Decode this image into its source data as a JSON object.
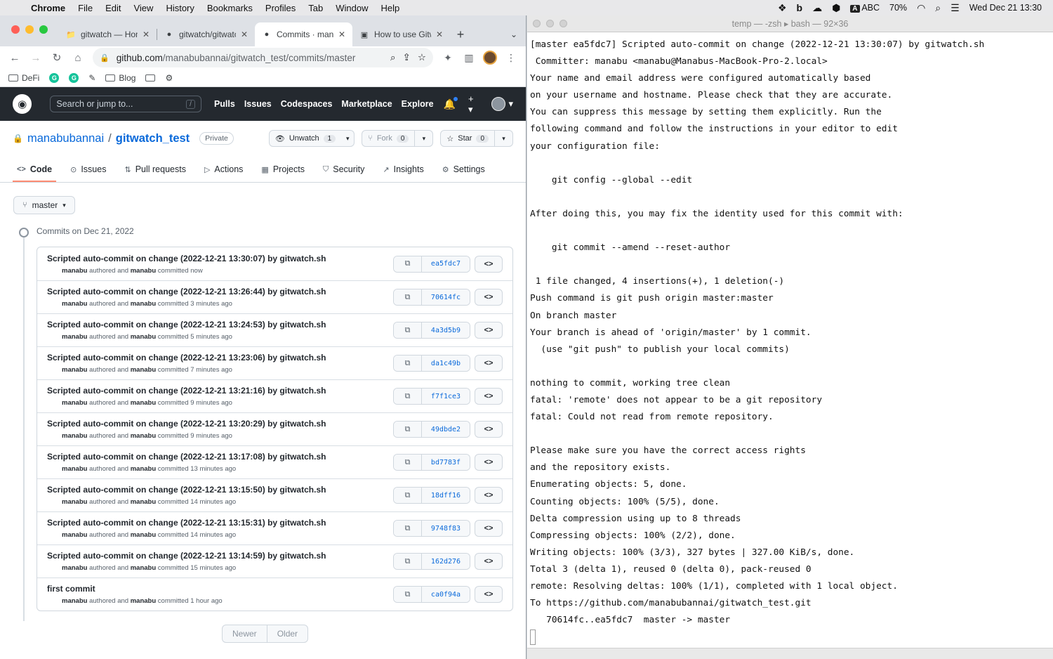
{
  "menubar": {
    "app": "Chrome",
    "items": [
      "File",
      "Edit",
      "View",
      "History",
      "Bookmarks",
      "Profiles",
      "Tab",
      "Window",
      "Help"
    ],
    "input_source": "ABC",
    "battery": "70%",
    "datetime": "Wed Dec 21  13:30"
  },
  "browser": {
    "tabs": [
      {
        "label": "gitwatch — Hom"
      },
      {
        "label": "gitwatch/gitwatc"
      },
      {
        "label": "Commits · mana"
      },
      {
        "label": "How to use Gitw"
      }
    ],
    "url_host": "github.com",
    "url_path": "/manabubannai/gitwatch_test/commits/master",
    "bookmarks": [
      "DeFi",
      "Blog"
    ]
  },
  "github": {
    "search_placeholder": "Search or jump to...",
    "search_key": "/",
    "nav": [
      "Pulls",
      "Issues",
      "Codespaces",
      "Marketplace",
      "Explore"
    ],
    "repo_owner": "manabubannai",
    "repo_sep": "/",
    "repo_name": "gitwatch_test",
    "visibility": "Private",
    "unwatch_label": "Unwatch",
    "unwatch_count": "1",
    "fork_label": "Fork",
    "fork_count": "0",
    "star_label": "Star",
    "star_count": "0",
    "tabs": [
      "Code",
      "Issues",
      "Pull requests",
      "Actions",
      "Projects",
      "Security",
      "Insights",
      "Settings"
    ],
    "branch": "master",
    "commits_date": "Commits on Dec 21, 2022",
    "commits": [
      {
        "title": "Scripted auto-commit on change (2022-12-21 13:30:07) by gitwatch.sh",
        "author": "manabu",
        "committer": "manabu",
        "when": "committed now",
        "sha": "ea5fdc7"
      },
      {
        "title": "Scripted auto-commit on change (2022-12-21 13:26:44) by gitwatch.sh",
        "author": "manabu",
        "committer": "manabu",
        "when": "committed 3 minutes ago",
        "sha": "70614fc"
      },
      {
        "title": "Scripted auto-commit on change (2022-12-21 13:24:53) by gitwatch.sh",
        "author": "manabu",
        "committer": "manabu",
        "when": "committed 5 minutes ago",
        "sha": "4a3d5b9"
      },
      {
        "title": "Scripted auto-commit on change (2022-12-21 13:23:06) by gitwatch.sh",
        "author": "manabu",
        "committer": "manabu",
        "when": "committed 7 minutes ago",
        "sha": "da1c49b"
      },
      {
        "title": "Scripted auto-commit on change (2022-12-21 13:21:16) by gitwatch.sh",
        "author": "manabu",
        "committer": "manabu",
        "when": "committed 9 minutes ago",
        "sha": "f7f1ce3"
      },
      {
        "title": "Scripted auto-commit on change (2022-12-21 13:20:29) by gitwatch.sh",
        "author": "manabu",
        "committer": "manabu",
        "when": "committed 9 minutes ago",
        "sha": "49dbde2"
      },
      {
        "title": "Scripted auto-commit on change (2022-12-21 13:17:08) by gitwatch.sh",
        "author": "manabu",
        "committer": "manabu",
        "when": "committed 13 minutes ago",
        "sha": "bd7783f"
      },
      {
        "title": "Scripted auto-commit on change (2022-12-21 13:15:50) by gitwatch.sh",
        "author": "manabu",
        "committer": "manabu",
        "when": "committed 14 minutes ago",
        "sha": "18dff16"
      },
      {
        "title": "Scripted auto-commit on change (2022-12-21 13:15:31) by gitwatch.sh",
        "author": "manabu",
        "committer": "manabu",
        "when": "committed 14 minutes ago",
        "sha": "9748f83"
      },
      {
        "title": "Scripted auto-commit on change (2022-12-21 13:14:59) by gitwatch.sh",
        "author": "manabu",
        "committer": "manabu",
        "when": "committed 15 minutes ago",
        "sha": "162d276"
      },
      {
        "title": "first commit",
        "author": "manabu",
        "committer": "manabu",
        "when": "committed 1 hour ago",
        "sha": "ca0f94a"
      }
    ],
    "authored_word": "authored and",
    "pager_newer": "Newer",
    "pager_older": "Older"
  },
  "terminal": {
    "title": "temp — -zsh ▸ bash — 92×36",
    "lines": [
      "[master ea5fdc7] Scripted auto-commit on change (2022-12-21 13:30:07) by gitwatch.sh",
      " Committer: manabu <manabu@Manabus-MacBook-Pro-2.local>",
      "Your name and email address were configured automatically based",
      "on your username and hostname. Please check that they are accurate.",
      "You can suppress this message by setting them explicitly. Run the",
      "following command and follow the instructions in your editor to edit",
      "your configuration file:",
      "",
      "    git config --global --edit",
      "",
      "After doing this, you may fix the identity used for this commit with:",
      "",
      "    git commit --amend --reset-author",
      "",
      " 1 file changed, 4 insertions(+), 1 deletion(-)",
      "Push command is git push origin master:master",
      "On branch master",
      "Your branch is ahead of 'origin/master' by 1 commit.",
      "  (use \"git push\" to publish your local commits)",
      "",
      "nothing to commit, working tree clean",
      "fatal: 'remote' does not appear to be a git repository",
      "fatal: Could not read from remote repository.",
      "",
      "Please make sure you have the correct access rights",
      "and the repository exists.",
      "Enumerating objects: 5, done.",
      "Counting objects: 100% (5/5), done.",
      "Delta compression using up to 8 threads",
      "Compressing objects: 100% (2/2), done.",
      "Writing objects: 100% (3/3), 327 bytes | 327.00 KiB/s, done.",
      "Total 3 (delta 1), reused 0 (delta 0), pack-reused 0",
      "remote: Resolving deltas: 100% (1/1), completed with 1 local object.",
      "To https://github.com/manabubannai/gitwatch_test.git",
      "   70614fc..ea5fdc7  master -> master"
    ]
  }
}
